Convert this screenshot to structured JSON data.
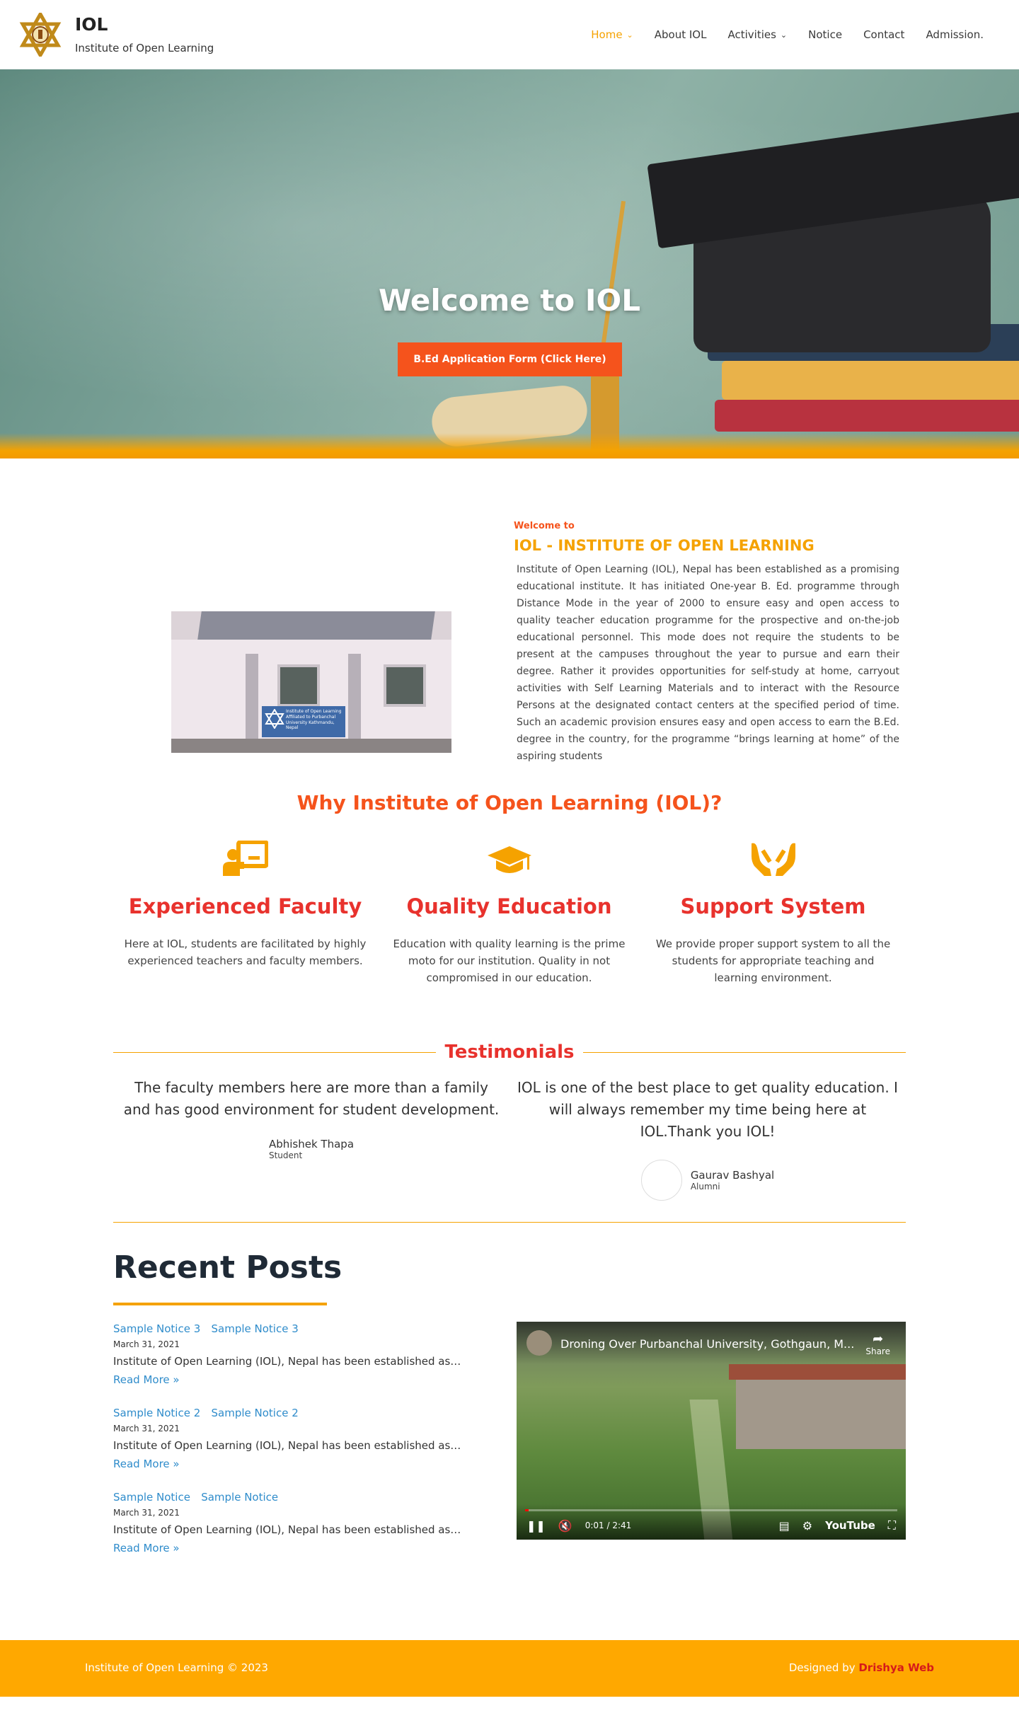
{
  "header": {
    "site_title": "IOL",
    "tagline": "Institute of Open Learning",
    "nav": [
      {
        "label": "Home",
        "has_dropdown": true,
        "active": true
      },
      {
        "label": "About IOL",
        "has_dropdown": false,
        "active": false
      },
      {
        "label": "Activities",
        "has_dropdown": true,
        "active": false
      },
      {
        "label": "Notice",
        "has_dropdown": false,
        "active": false
      },
      {
        "label": "Contact",
        "has_dropdown": false,
        "active": false
      },
      {
        "label": "Admission.",
        "has_dropdown": false,
        "active": false
      }
    ]
  },
  "hero": {
    "title": "Welcome to IOL",
    "button_label": "B.Ed Application Form (Click Here)"
  },
  "about": {
    "eyebrow": "Welcome to",
    "title": "IOL - INSTITUTE OF OPEN LEARNING",
    "image_sign_text": "Institute of Open Learning Affiliated to Purbanchal University Kathmandu, Nepal",
    "body": "Institute of Open Learning (IOL), Nepal has been established as a promising educational institute. It has initiated One-year B. Ed. programme through Distance Mode in the year of 2000 to ensure easy and open access to quality teacher education programme for the prospective and on-the-job educational personnel. This mode does not require the students to be present at the campuses throughout the year to pursue and earn their degree. Rather it provides opportunities for self-study at home, carryout activities with Self Learning Materials and to interact with the Resource Persons at the designated contact centers at the specified period of time. Such an academic provision ensures easy and open access to earn the B.Ed. degree in the country, for the programme “brings learning at home” of the aspiring students"
  },
  "why": {
    "title": "Why Institute of Open Learning (IOL)?",
    "features": [
      {
        "icon": "teacher-board-icon",
        "title": "Experienced Faculty",
        "desc": "Here at IOL, students are facilitated by highly experienced teachers and faculty members."
      },
      {
        "icon": "graduation-cap-icon",
        "title": "Quality Education",
        "desc": "Education with quality learning is the prime moto for our institution. Quality in not compromised in our education."
      },
      {
        "icon": "hands-support-icon",
        "title": "Support System",
        "desc": "We provide proper support system to all the students for appropriate teaching and learning environment."
      }
    ]
  },
  "testimonials": {
    "title": "Testimonials",
    "items": [
      {
        "quote": "The faculty members here are more than a family and has good environment for student development.",
        "name": "Abhishek Thapa",
        "role": "Student"
      },
      {
        "quote": "IOL is one of the best place to get quality education. I will always remember my time being here at IOL.Thank you IOL!",
        "name": "Gaurav Bashyal",
        "role": "Alumni"
      }
    ]
  },
  "recent": {
    "title": "Recent Posts",
    "posts": [
      {
        "image_alt": "Sample Notice 3",
        "title": "Sample Notice 3",
        "date": "March 31, 2021",
        "excerpt": "Institute of Open Learning (IOL), Nepal has been established as…",
        "read_more": "Read More »"
      },
      {
        "image_alt": "Sample Notice 2",
        "title": "Sample Notice 2",
        "date": "March 31, 2021",
        "excerpt": "Institute of Open Learning (IOL), Nepal has been established as…",
        "read_more": "Read More »"
      },
      {
        "image_alt": "Sample Notice",
        "title": "Sample Notice",
        "date": "March 31, 2021",
        "excerpt": "Institute of Open Learning (IOL), Nepal has been established as…",
        "read_more": "Read More »"
      }
    ],
    "video": {
      "title": "Droning Over Purbanchal University, Gothgaun, M...",
      "share_label": "Share",
      "time": "0:01 / 2:41",
      "progress": 0.01,
      "logo": "YouTube"
    }
  },
  "footer": {
    "copyright": "Institute of Open Learning © 2023",
    "designed_by": "Designed by",
    "designer": "Drishya Web"
  },
  "colors": {
    "accent": "#f5a200",
    "cta": "#f5531c",
    "heading_red": "#e8322d",
    "link": "#2f8ccb",
    "footer_bg": "#ffa800"
  }
}
